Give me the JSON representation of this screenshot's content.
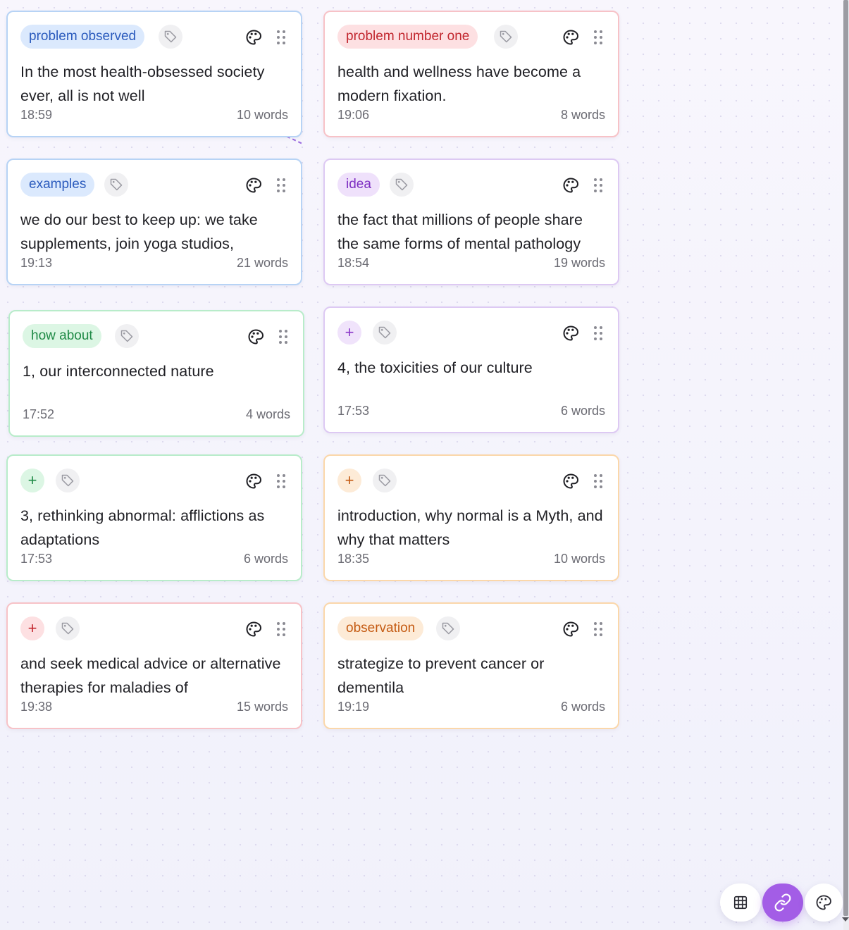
{
  "colors": {
    "blue": "#b7d3f5",
    "red": "#f7c2c7",
    "purple": "#ddc9f3",
    "green": "#b8ecca",
    "orange": "#fbd7aa",
    "accent": "#a35de6"
  },
  "cards": [
    {
      "label": "problem observed",
      "text": "In the most health-obsessed society ever, all is not well",
      "time": "18:59",
      "words": "10 words"
    },
    {
      "label": "problem number one",
      "text": "health and wellness have become a modern fixation.",
      "time": "19:06",
      "words": "8 words"
    },
    {
      "label": "examples",
      "text": "we do our best to keep up: we take supplements, join yoga studios,",
      "time": "19:13",
      "words": "21 words"
    },
    {
      "label": "idea",
      "text": "the fact that millions of people share the same forms of mental pathology",
      "time": "18:54",
      "words": "19 words"
    },
    {
      "label": "how about",
      "text": "1, our interconnected nature",
      "time": "17:52",
      "words": "4 words"
    },
    {
      "label": "+",
      "text": "4, the toxicities of our culture",
      "time": "17:53",
      "words": "6 words"
    },
    {
      "label": "+",
      "text": "3, rethinking abnormal: afflictions as adaptations",
      "time": "17:53",
      "words": "6 words"
    },
    {
      "label": "+",
      "text": "introduction, why normal is a Myth, and why that matters",
      "time": "18:35",
      "words": "10 words"
    },
    {
      "label": "+",
      "text": "and seek medical advice or alternative therapies for maladies of",
      "time": "19:38",
      "words": "15 words"
    },
    {
      "label": "observation",
      "text": "strategize to prevent cancer or dementila",
      "time": "19:19",
      "words": "6 words"
    }
  ],
  "icons": {
    "tag": "tag-icon",
    "palette": "palette-icon",
    "grip": "drag-handle-icon",
    "grid": "grid-icon",
    "link": "link-icon"
  }
}
